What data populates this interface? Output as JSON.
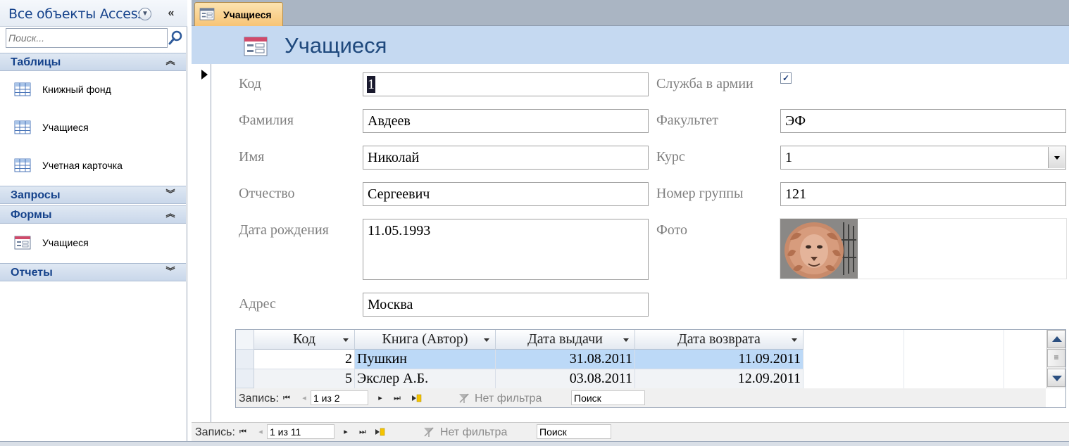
{
  "nav": {
    "title": "Все объекты Access",
    "search_placeholder": "Поиск...",
    "groups": {
      "tables": {
        "label": "Таблицы",
        "items": [
          "Книжный фонд",
          "Учащиеся",
          "Учетная карточка"
        ]
      },
      "queries": {
        "label": "Запросы"
      },
      "forms": {
        "label": "Формы",
        "items": [
          "Учащиеся"
        ]
      },
      "reports": {
        "label": "Отчеты"
      }
    }
  },
  "document_tab": {
    "label": "Учащиеся"
  },
  "form": {
    "title": "Учащиеся",
    "fields": {
      "kod": {
        "label": "Код",
        "value": "1"
      },
      "familiya": {
        "label": "Фамилия",
        "value": "Авдеев"
      },
      "imya": {
        "label": "Имя",
        "value": "Николай"
      },
      "otchestvo": {
        "label": "Отчество",
        "value": "Сергеевич"
      },
      "data_rozhdeniya": {
        "label": "Дата рождения",
        "value": "11.05.1993"
      },
      "adres": {
        "label": "Адрес",
        "value": "Москва"
      },
      "sluzhba": {
        "label": "Служба в армии",
        "checked": true
      },
      "fakultet": {
        "label": "Факультет",
        "value": "ЭФ"
      },
      "kurs": {
        "label": "Курс",
        "value": "1"
      },
      "nomer_gruppy": {
        "label": "Номер группы",
        "value": "121"
      },
      "foto": {
        "label": "Фото"
      }
    }
  },
  "subform": {
    "columns": [
      "Код",
      "Книга (Автор)",
      "Дата выдачи",
      "Дата возврата"
    ],
    "rows": [
      {
        "kod": "2",
        "kniga": "Пушкин",
        "vydacha": "31.08.2011",
        "vozvrat": "11.09.2011"
      },
      {
        "kod": "5",
        "kniga": "Экслер А.Б.",
        "vydacha": "03.08.2011",
        "vozvrat": "12.09.2011"
      }
    ],
    "navbar": {
      "record_label": "Запись:",
      "position": "1 из 2",
      "filter": "Нет фильтра",
      "search": "Поиск"
    }
  },
  "main_navbar": {
    "record_label": "Запись:",
    "position": "1 из 11",
    "filter": "Нет фильтра",
    "search": "Поиск"
  },
  "colors": {
    "header_bg": "#c5d9f1",
    "title_color": "#1f497d",
    "nav_group_text": "#15428b",
    "tab_active": "#f7c476",
    "selected_row": "#bcd9f7"
  }
}
